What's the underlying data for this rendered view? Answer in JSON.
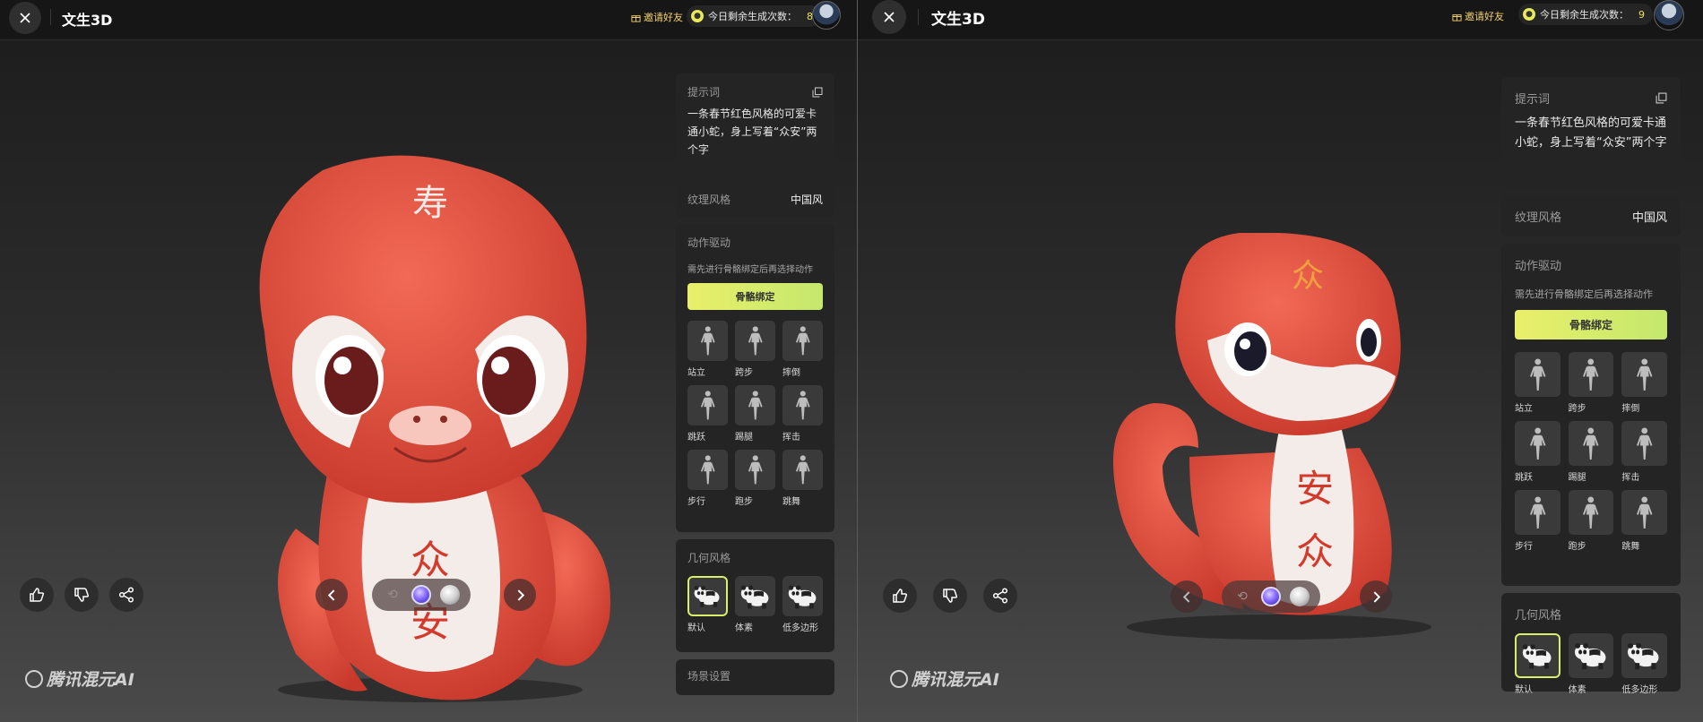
{
  "app_title": "文生3D",
  "header": {
    "invite_label": "邀请好友",
    "quota_label": "今日剩余生成次数：",
    "left_quota": "8",
    "right_quota": "9"
  },
  "panel": {
    "prompt_title": "提示词",
    "prompt_text": "一条春节红色风格的可爱卡通小蛇，身上写着“众安”两个字",
    "texture_label": "纹理风格",
    "texture_value": "中国风",
    "motion_title": "动作驱动",
    "motion_hint": "需先进行骨骼绑定后再选择动作",
    "rig_button": "骨骼绑定",
    "motions": [
      "站立",
      "跨步",
      "摔倒",
      "跳跃",
      "踢腿",
      "挥击",
      "步行",
      "跑步",
      "跳舞"
    ],
    "geometry_title": "几何风格",
    "geometry_options": [
      "默认",
      "体素",
      "低多边形"
    ],
    "scene_title": "场景设置"
  },
  "brand": "腾讯混元AI",
  "icons": {
    "close": "close-icon",
    "invite": "gift-icon",
    "copy": "copy-icon",
    "like": "thumbs-up-icon",
    "dislike": "thumbs-down-icon",
    "share": "share-icon",
    "prev": "chevron-left-icon",
    "next": "chevron-right-icon"
  },
  "colors": {
    "accent": "#e9ef6a",
    "snake_red": "#e8513f",
    "background": "#1b1b1b"
  }
}
